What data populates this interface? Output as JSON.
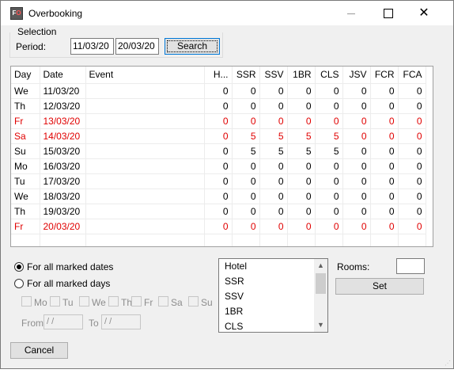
{
  "window": {
    "title": "Overbooking"
  },
  "selection": {
    "legend": "Selection",
    "period_label": "Period:",
    "date_from": "11/03/20",
    "date_to": "20/03/20",
    "search_label": "Search"
  },
  "grid": {
    "headers": [
      "Day",
      "Date",
      "Event",
      "H...",
      "SSR",
      "SSV",
      "1BR",
      "CLS",
      "JSV",
      "FCR",
      "FCA"
    ],
    "rows": [
      {
        "day": "We",
        "date": "11/03/20",
        "event": "",
        "values": [
          "0",
          "0",
          "0",
          "0",
          "0",
          "0",
          "0",
          "0"
        ],
        "weekend": false
      },
      {
        "day": "Th",
        "date": "12/03/20",
        "event": "",
        "values": [
          "0",
          "0",
          "0",
          "0",
          "0",
          "0",
          "0",
          "0"
        ],
        "weekend": false
      },
      {
        "day": "Fr",
        "date": "13/03/20",
        "event": "",
        "values": [
          "0",
          "0",
          "0",
          "0",
          "0",
          "0",
          "0",
          "0"
        ],
        "weekend": true
      },
      {
        "day": "Sa",
        "date": "14/03/20",
        "event": "",
        "values": [
          "0",
          "5",
          "5",
          "5",
          "5",
          "0",
          "0",
          "0"
        ],
        "weekend": true
      },
      {
        "day": "Su",
        "date": "15/03/20",
        "event": "",
        "values": [
          "0",
          "5",
          "5",
          "5",
          "5",
          "0",
          "0",
          "0"
        ],
        "weekend": false
      },
      {
        "day": "Mo",
        "date": "16/03/20",
        "event": "",
        "values": [
          "0",
          "0",
          "0",
          "0",
          "0",
          "0",
          "0",
          "0"
        ],
        "weekend": false
      },
      {
        "day": "Tu",
        "date": "17/03/20",
        "event": "",
        "values": [
          "0",
          "0",
          "0",
          "0",
          "0",
          "0",
          "0",
          "0"
        ],
        "weekend": false
      },
      {
        "day": "We",
        "date": "18/03/20",
        "event": "",
        "values": [
          "0",
          "0",
          "0",
          "0",
          "0",
          "0",
          "0",
          "0"
        ],
        "weekend": false
      },
      {
        "day": "Th",
        "date": "19/03/20",
        "event": "",
        "values": [
          "0",
          "0",
          "0",
          "0",
          "0",
          "0",
          "0",
          "0"
        ],
        "weekend": false
      },
      {
        "day": "Fr",
        "date": "20/03/20",
        "event": "",
        "values": [
          "0",
          "0",
          "0",
          "0",
          "0",
          "0",
          "0",
          "0"
        ],
        "weekend": true
      }
    ],
    "weekend_color": "#e00000"
  },
  "options": {
    "radio_marked_dates": "For all marked dates",
    "radio_marked_days": "For all  marked days",
    "weekday_labels": [
      "Mo",
      "Tu",
      "We",
      "Th",
      "Fr",
      "Sa",
      "Su"
    ],
    "from_label": "From",
    "to_label": "To",
    "from_value": "/ /",
    "to_value": "/ /"
  },
  "room_types": [
    "Hotel",
    "SSR",
    "SSV",
    "1BR",
    "CLS"
  ],
  "rooms": {
    "label": "Rooms:",
    "value": "",
    "set_label": "Set"
  },
  "footer": {
    "cancel_label": "Cancel"
  }
}
